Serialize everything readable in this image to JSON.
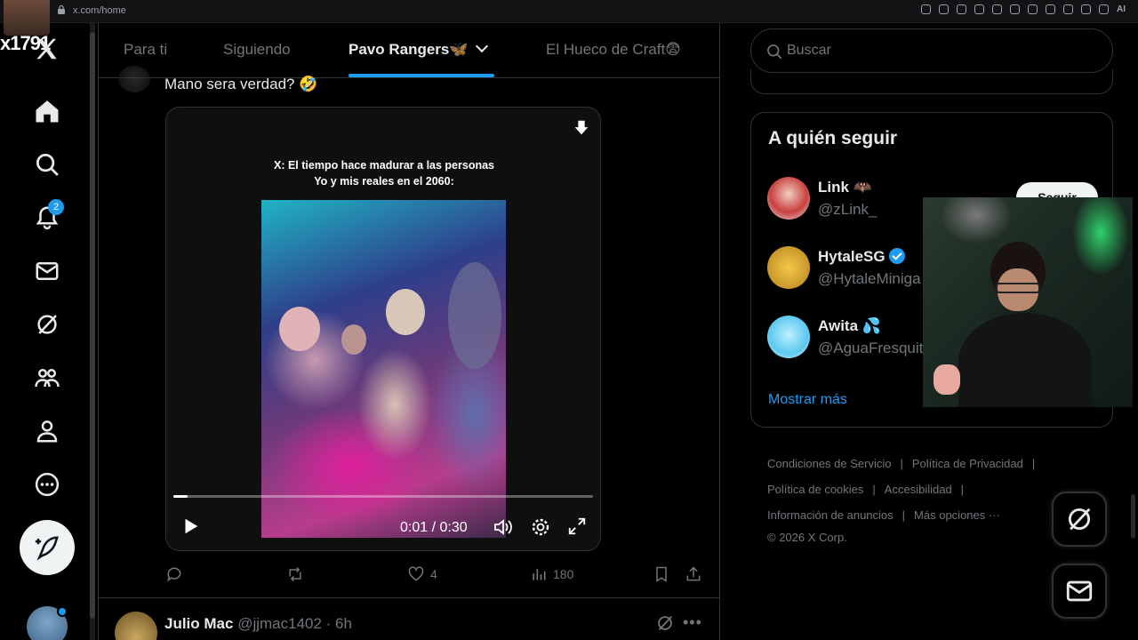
{
  "browser": {
    "url": "x.com/home",
    "ext_label": "AI"
  },
  "overlay": {
    "streamer_tag": "x1791"
  },
  "nav": {
    "notifications_count": "2"
  },
  "tabs": [
    {
      "label": "Para ti"
    },
    {
      "label": "Siguiendo"
    },
    {
      "label": "Pavo Rangers🦋"
    },
    {
      "label": "El Hueco de Craft😨"
    }
  ],
  "tweet": {
    "text": "Mano sera verdad? 🤣",
    "caption_line1": "X: El tiempo hace madurar a las personas",
    "caption_line2": "Yo y mis reales en el 2060:",
    "video": {
      "time": "0:01 / 0:30",
      "progress_fraction": 0.033
    },
    "likes": "4",
    "views": "180"
  },
  "next_tweet": {
    "name": "Julio Mac",
    "meta": "@jjmac1402 · 6h"
  },
  "search": {
    "placeholder": "Buscar"
  },
  "who_to_follow": {
    "title": "A quién seguir",
    "follow_label": "Seguir",
    "users": [
      {
        "name": "Link 🦇",
        "handle": "@zLink_"
      },
      {
        "name": "HytaleSG",
        "handle": "@HytaleMiniga"
      },
      {
        "name": "Awita 💦",
        "handle": "@AguaFresquit"
      }
    ],
    "show_more": "Mostrar más"
  },
  "footer": {
    "terms": "Condiciones de Servicio",
    "privacy": "Política de Privacidad",
    "cookies": "Política de cookies",
    "accessibility": "Accesibilidad",
    "ads": "Información de anuncios",
    "more": "Más opciones ···",
    "copyright": "© 2026 X Corp."
  },
  "colors": {
    "accent": "#1d9bf0",
    "background": "#000000",
    "muted": "#71767b",
    "text": "#e7e9ea"
  }
}
